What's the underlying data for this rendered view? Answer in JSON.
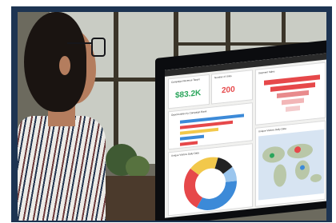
{
  "scene": {
    "description_free": true,
    "colors": {
      "frame": "#1d3452",
      "accent_red": "#e6484a",
      "accent_blue": "#3c8ad8",
      "accent_yellow": "#f2c84b",
      "accent_green": "#2aa55b"
    }
  },
  "dashboard": {
    "tiles": [
      {
        "label": "Campaign Revenue Target"
      },
      {
        "label": "Number of Units"
      },
      {
        "label": "Segment Sales"
      },
      {
        "label": "Opportunities by Campaign Rank"
      },
      {
        "label": "Unique Visitors Daily Data"
      },
      {
        "label": "Unique Visitors Daily Data"
      }
    ],
    "kpi_revenue": "$83.2K",
    "kpi_units": "200"
  }
}
